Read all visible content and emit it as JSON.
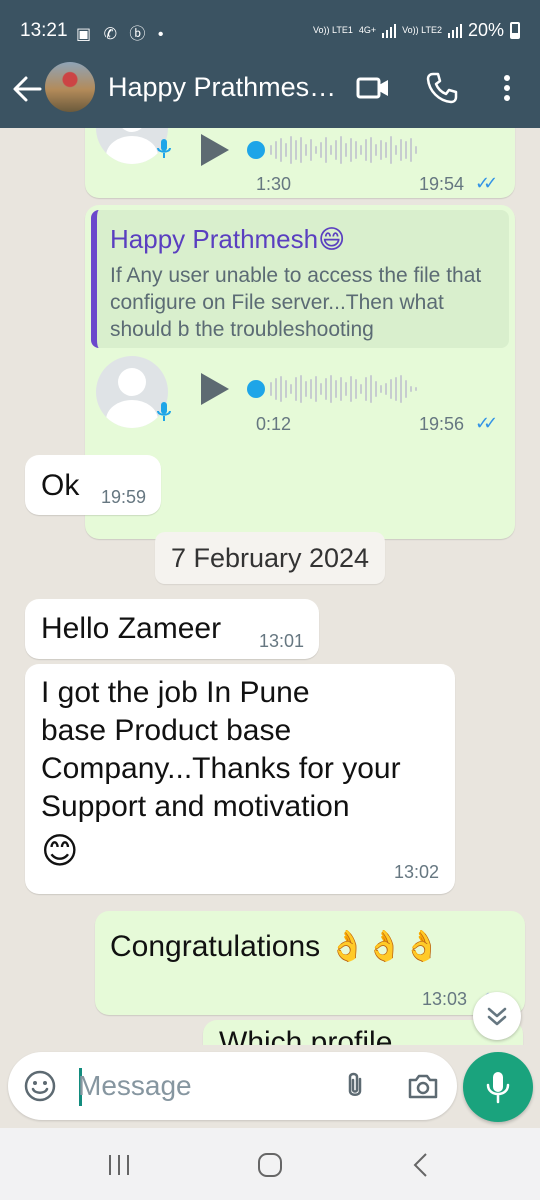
{
  "status_bar": {
    "time": "13:21",
    "left_icons": "▣ ✆ ⓑ •",
    "net1": "Vo)) LTE1",
    "net2": "4G+",
    "net3": "Vo)) LTE2",
    "battery": "20%"
  },
  "header": {
    "contact_name": "Happy Prathmes…"
  },
  "messages": {
    "voice1": {
      "duration": "1:30",
      "time": "19:54"
    },
    "voice2": {
      "reply_name": "Happy Prathmesh😄",
      "reply_text": "If Any user unable to access the file that configure on File server...Then what should b the troubleshooting",
      "duration": "0:12",
      "time": "19:56"
    },
    "ok": {
      "text": "Ok",
      "time": "19:59"
    },
    "date_divider": "7 February 2024",
    "hello": {
      "text": "Hello Zameer",
      "time": "13:01"
    },
    "job": {
      "lines": [
        "I got the job In Pune",
        "base Product base",
        "Company...Thanks for your",
        "Support and motivation"
      ],
      "emoji": "😊",
      "time": "13:02"
    },
    "congrats": {
      "text": "Congratulations 👌👌👌",
      "time": "13:03"
    },
    "partial": {
      "text": "Which profile"
    }
  },
  "input": {
    "placeholder": "Message"
  },
  "colors": {
    "header_bg": "#3b5362",
    "outgoing_bubble": "#e6fad8",
    "incoming_bubble": "#ffffff",
    "chat_bg": "#e9e5de",
    "tick_blue": "#3393e6",
    "mic_green": "#1aa37d"
  },
  "icons": {
    "back": "arrow-left-icon",
    "video": "video-camera-icon",
    "call": "phone-icon",
    "menu": "more-vertical-icon",
    "emoji": "emoji-icon",
    "attach": "paperclip-icon",
    "camera": "camera-icon",
    "mic": "microphone-icon"
  }
}
